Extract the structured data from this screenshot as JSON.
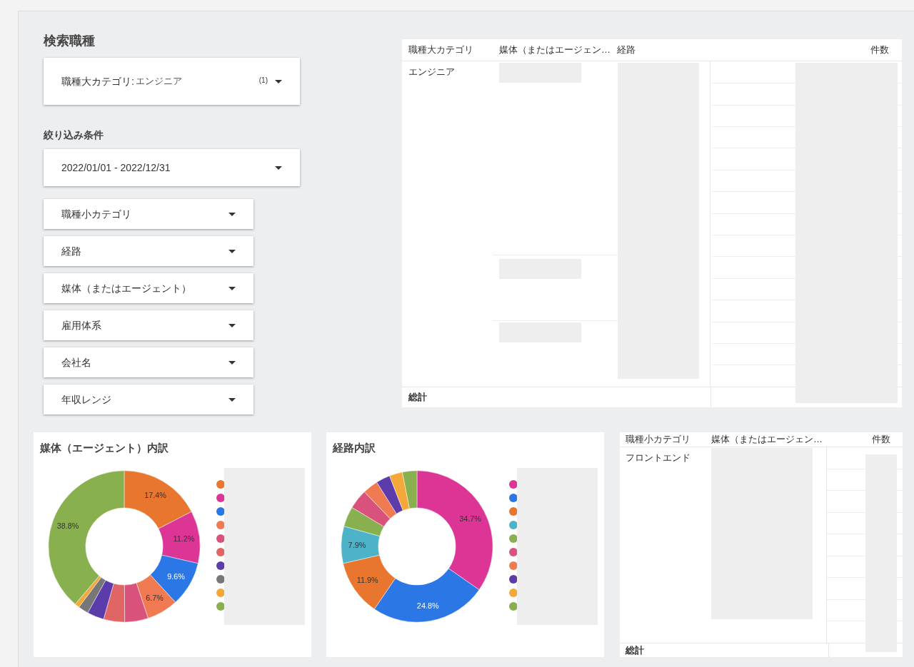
{
  "filters": {
    "title": "検索職種",
    "primary": {
      "label": "職種大カテゴリ:",
      "value": "エンジニア",
      "count": "(1)"
    },
    "section_label": "絞り込み条件",
    "date_range": "2022/01/01 - 2022/12/31",
    "dropdowns": [
      "職種小カテゴリ",
      "経路",
      "媒体（またはエージェント）",
      "雇用体系",
      "会社名",
      "年収レンジ"
    ]
  },
  "main_table": {
    "columns": [
      "職種大カテゴリ",
      "媒体（またはエージェン…",
      "経路",
      "件数"
    ],
    "rows": [
      {
        "cells": [
          "エンジニア"
        ]
      }
    ],
    "total_label": "総計"
  },
  "charts": [
    {
      "title": "媒体（エージェント）内訳",
      "chart_data": {
        "type": "donut",
        "values": [
          17.4,
          11.2,
          9.6,
          6.7,
          5.0,
          4.5,
          3.6,
          2.2,
          1.0,
          38.8
        ],
        "value_labels": [
          "17.4%",
          "11.2%",
          "9.6%",
          "6.7%",
          null,
          null,
          null,
          null,
          null,
          "38.8%"
        ]
      },
      "legend": [
        {
          "color": "#e8762f"
        },
        {
          "color": "#dc3596"
        },
        {
          "color": "#2b77e5"
        },
        {
          "color": "#f07b52"
        },
        {
          "color": "#d9527c"
        },
        {
          "color": "#e06666"
        },
        {
          "color": "#5c3bab"
        },
        {
          "color": "#777777"
        },
        {
          "color": "#f5a83a"
        },
        {
          "color": "#88b04f"
        }
      ]
    },
    {
      "title": "経路内訳",
      "chart_data": {
        "type": "donut",
        "values": [
          34.7,
          24.8,
          11.9,
          7.9,
          4.3,
          4.2,
          3.3,
          3.0,
          2.8,
          3.1
        ],
        "value_labels": [
          "34.7%",
          "24.8%",
          "11.9%",
          "7.9%",
          null,
          null,
          null,
          null,
          null,
          null
        ]
      },
      "legend": [
        {
          "color": "#dc3596"
        },
        {
          "color": "#2b77e5"
        },
        {
          "color": "#e8762f"
        },
        {
          "color": "#4db3c8"
        },
        {
          "color": "#88b04f"
        },
        {
          "color": "#d9527c"
        },
        {
          "color": "#f07b52"
        },
        {
          "color": "#5c3bab"
        },
        {
          "color": "#f5a83a"
        },
        {
          "color": "#88b04f"
        }
      ]
    }
  ],
  "sub_table": {
    "columns": [
      "職種小カテゴリ",
      "媒体（またはエージェン…",
      "件数"
    ],
    "rows": [
      {
        "cells": [
          "フロントエンド"
        ]
      }
    ],
    "total_label": "総計"
  }
}
